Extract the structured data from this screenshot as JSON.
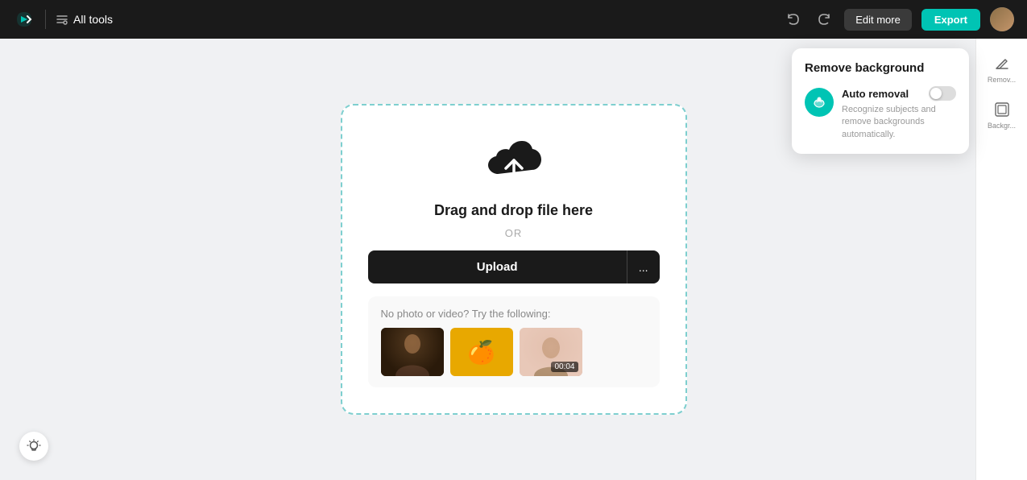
{
  "app": {
    "logo_label": "Capcut",
    "all_tools_label": "All tools"
  },
  "nav": {
    "edit_more_label": "Edit more",
    "export_label": "Export"
  },
  "drop_zone": {
    "drag_drop_text": "Drag and drop file here",
    "or_text": "OR",
    "upload_label": "Upload",
    "more_options_label": "...",
    "sample_prompt": "No photo or video? Try the following:",
    "sample_thumbnails": [
      {
        "id": "thumb-person",
        "type": "image",
        "alt": "Person photo"
      },
      {
        "id": "thumb-fruit",
        "type": "image",
        "alt": "Fruit on yellow background"
      },
      {
        "id": "thumb-video",
        "type": "video",
        "alt": "Video thumbnail",
        "duration": "00:04"
      }
    ]
  },
  "remove_bg_panel": {
    "title": "Remove background",
    "auto_removal_title": "Auto removal",
    "auto_removal_desc": "Recognize subjects and remove backgrounds automatically.",
    "toggle_state": false
  },
  "sidebar": {
    "items": [
      {
        "id": "remove",
        "label": "Remov...",
        "icon": "eraser"
      },
      {
        "id": "background",
        "label": "Backgr...",
        "icon": "image"
      }
    ]
  },
  "colors": {
    "accent": "#00c4b4",
    "dark": "#1a1a1a",
    "bg": "#f0f1f3"
  }
}
